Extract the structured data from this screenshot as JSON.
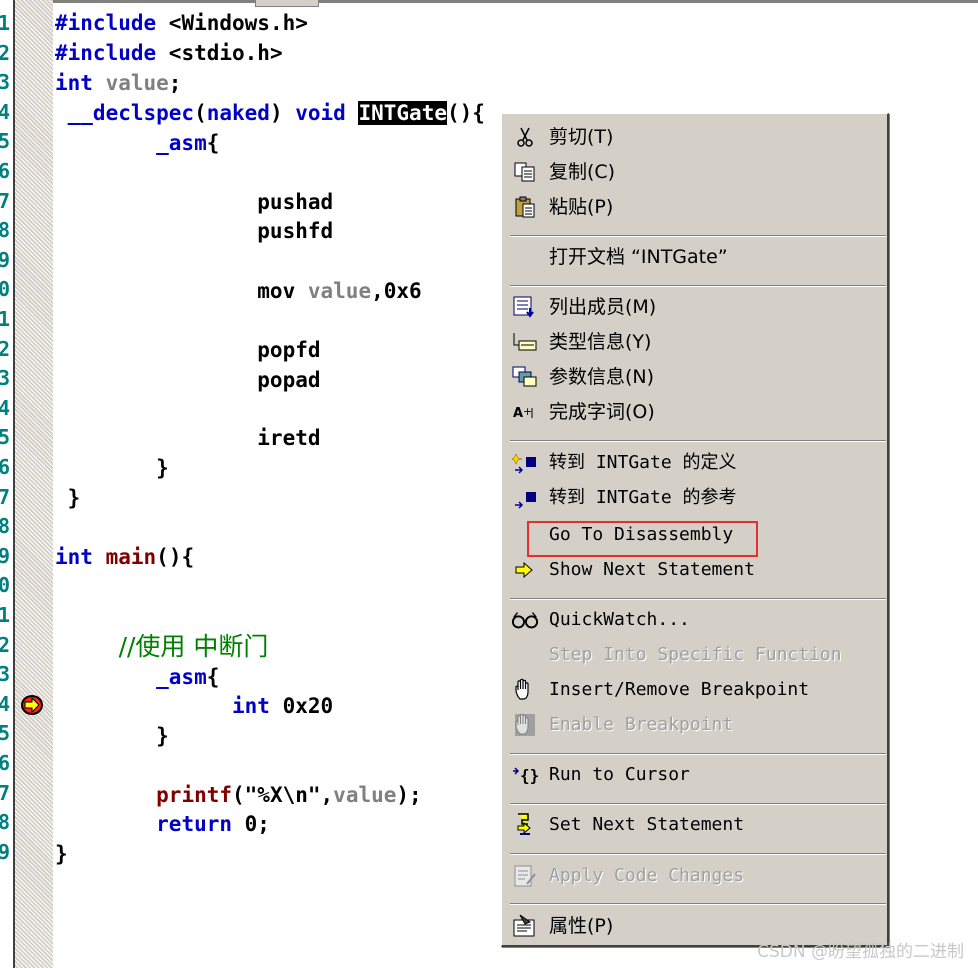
{
  "editor": {
    "line_numbers": [
      "1",
      "2",
      "3",
      "4",
      "5",
      "6",
      "7",
      "8",
      "9",
      "0",
      "1",
      "2",
      "3",
      "4",
      "5",
      "6",
      "7",
      "8",
      "9",
      "0",
      "1",
      "2",
      "3",
      "4",
      "5",
      "6",
      "7",
      "8",
      "9"
    ],
    "lines": {
      "l1_kw": "#include",
      "l1_rest": " <Windows.h>",
      "l2_kw": "#include",
      "l2_rest": " <stdio.h>",
      "l3_kw": "int",
      "l3_var": " value",
      "l3_rest": ";",
      "l4_kw1": " __declspec",
      "l4_p1": "(",
      "l4_kw2": "naked",
      "l4_p2": ") ",
      "l4_kw3": "void",
      "l4_sp": " ",
      "l4_sel": "INTGate",
      "l4_rest": "(){",
      "l5": "        _asm",
      "l5_rest": "{",
      "l7": "                pushad",
      "l8": "                pushfd",
      "l10": "                mov ",
      "l10_var": "value",
      "l10_rest": ",0x6",
      "l12": "                popfd",
      "l13": "                popad",
      "l15": "                iretd",
      "l16": "        }",
      "l17": " }",
      "l19_kw": "int",
      "l19_sp": " ",
      "l19_fn": "main",
      "l19_rest": "(){",
      "l22_cm": "        //使用 中断门",
      "l23": "        _asm",
      "l23_rest": "{",
      "l24_sp": "              ",
      "l24_kw": "int",
      "l24_rest": " 0x20",
      "l25": "        }",
      "l27_sp": "        ",
      "l27_fn": "printf",
      "l27_p1": "(\"%X\\n\",",
      "l27_var": "value",
      "l27_p2": ");",
      "l28_sp": "        ",
      "l28_kw": "return",
      "l28_rest": " 0;",
      "l29": "}"
    }
  },
  "menu": {
    "cut": "剪切(T)",
    "copy": "复制(C)",
    "paste": "粘贴(P)",
    "open_doc": "打开文档 “INTGate”",
    "list_members": "列出成员(M)",
    "type_info": "类型信息(Y)",
    "param_info": "参数信息(N)",
    "complete_word": "完成字词(O)",
    "goto_def": "转到 INTGate 的定义",
    "goto_ref": "转到 INTGate 的参考",
    "goto_disasm": "Go To Disassembly",
    "show_next": "Show Next Statement",
    "quickwatch": "QuickWatch...",
    "step_into": "Step Into Specific Function",
    "insert_bp": "Insert/Remove Breakpoint",
    "enable_bp": "Enable Breakpoint",
    "run_cursor": "Run to Cursor",
    "set_next": "Set Next Statement",
    "apply_changes": "Apply Code Changes",
    "properties": "属性(P)"
  },
  "colors": {
    "keyword": "#0000c8",
    "function": "#800000",
    "variable": "#808080",
    "comment": "#008000",
    "line_number": "#008080",
    "menu_bg": "#d4d0c8",
    "highlight_box": "#e03030"
  },
  "watermark": "CSDN @盼望孤独的二进制"
}
